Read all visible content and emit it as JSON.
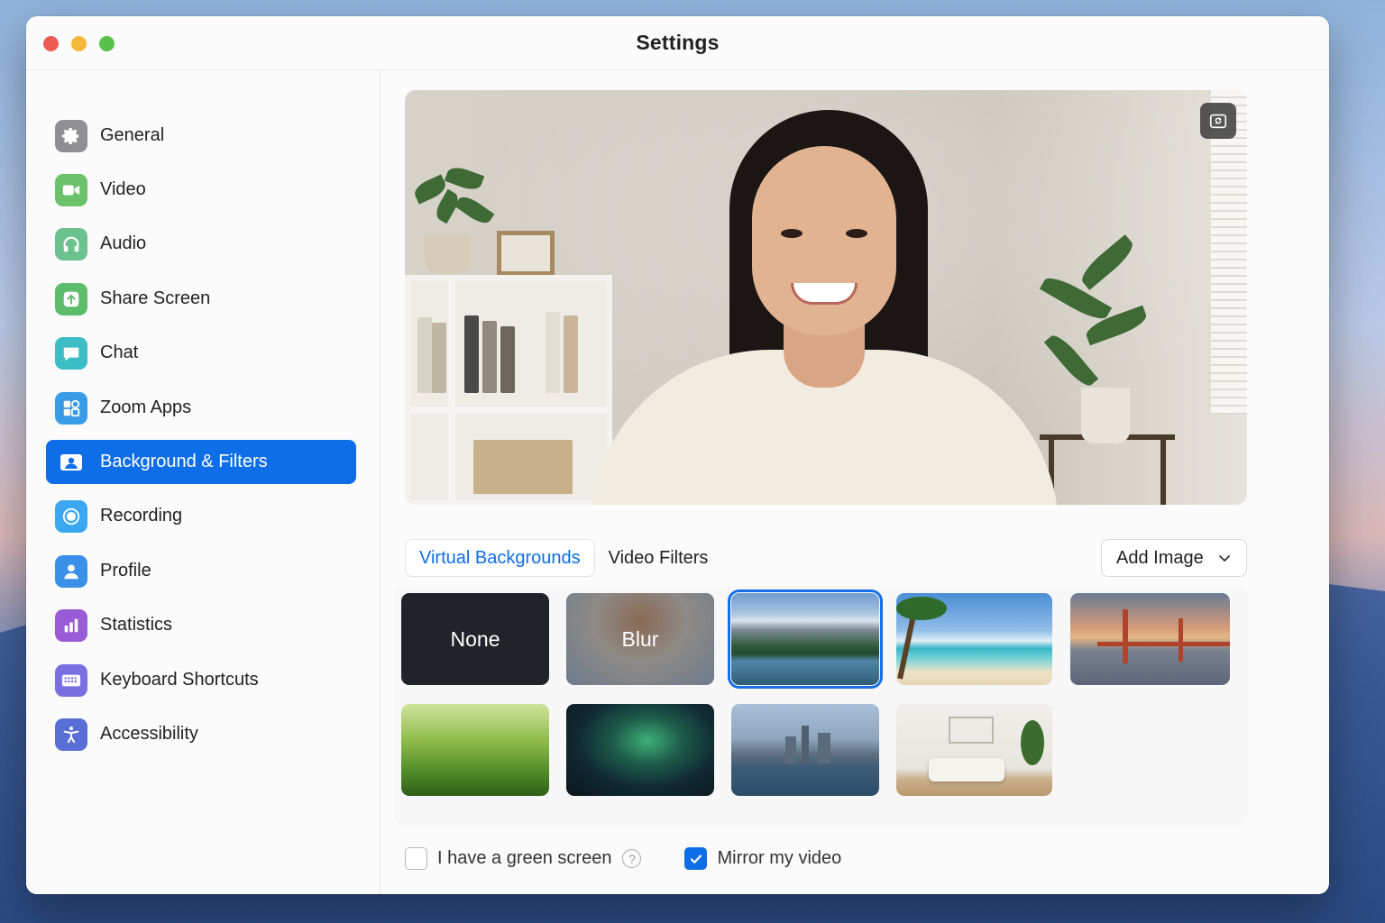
{
  "window": {
    "title": "Settings"
  },
  "sidebar": {
    "items": [
      {
        "label": "General",
        "icon": "gear-icon",
        "color": "#8e8e93"
      },
      {
        "label": "Video",
        "icon": "video-camera-icon",
        "color": "#6cc26a"
      },
      {
        "label": "Audio",
        "icon": "headphones-icon",
        "color": "#6cc28f"
      },
      {
        "label": "Share Screen",
        "icon": "share-screen-icon",
        "color": "#5dbd6d"
      },
      {
        "label": "Chat",
        "icon": "chat-bubble-icon",
        "color": "#3cbcc4"
      },
      {
        "label": "Zoom Apps",
        "icon": "apps-grid-icon",
        "color": "#3a9ce6"
      },
      {
        "label": "Background & Filters",
        "icon": "background-icon",
        "color": "#0e6ee8",
        "active": true
      },
      {
        "label": "Recording",
        "icon": "record-icon",
        "color": "#3aa7f0"
      },
      {
        "label": "Profile",
        "icon": "person-icon",
        "color": "#3a8fe8"
      },
      {
        "label": "Statistics",
        "icon": "bar-chart-icon",
        "color": "#9a5bd6"
      },
      {
        "label": "Keyboard Shortcuts",
        "icon": "keyboard-icon",
        "color": "#7a6fe0"
      },
      {
        "label": "Accessibility",
        "icon": "accessibility-icon",
        "color": "#5a6fd6"
      }
    ]
  },
  "preview": {
    "camera_button_icon": "switch-camera-icon"
  },
  "tabs": [
    {
      "label": "Virtual Backgrounds",
      "active": true
    },
    {
      "label": "Video Filters",
      "active": false
    }
  ],
  "add_image": {
    "label": "Add Image"
  },
  "backgrounds": [
    {
      "label": "None",
      "kind": "none"
    },
    {
      "label": "Blur",
      "kind": "blur"
    },
    {
      "label": "",
      "kind": "mountain-lake",
      "selected": true
    },
    {
      "label": "",
      "kind": "tropical-beach"
    },
    {
      "label": "",
      "kind": "golden-gate-bridge"
    },
    {
      "label": "",
      "kind": "grass"
    },
    {
      "label": "",
      "kind": "aurora"
    },
    {
      "label": "",
      "kind": "city-skyline"
    },
    {
      "label": "",
      "kind": "living-room"
    }
  ],
  "options": {
    "green_screen": {
      "label": "I have a green screen",
      "checked": false,
      "help": "?"
    },
    "mirror": {
      "label": "Mirror my video",
      "checked": true
    }
  },
  "accent_color": "#0e6ee8"
}
